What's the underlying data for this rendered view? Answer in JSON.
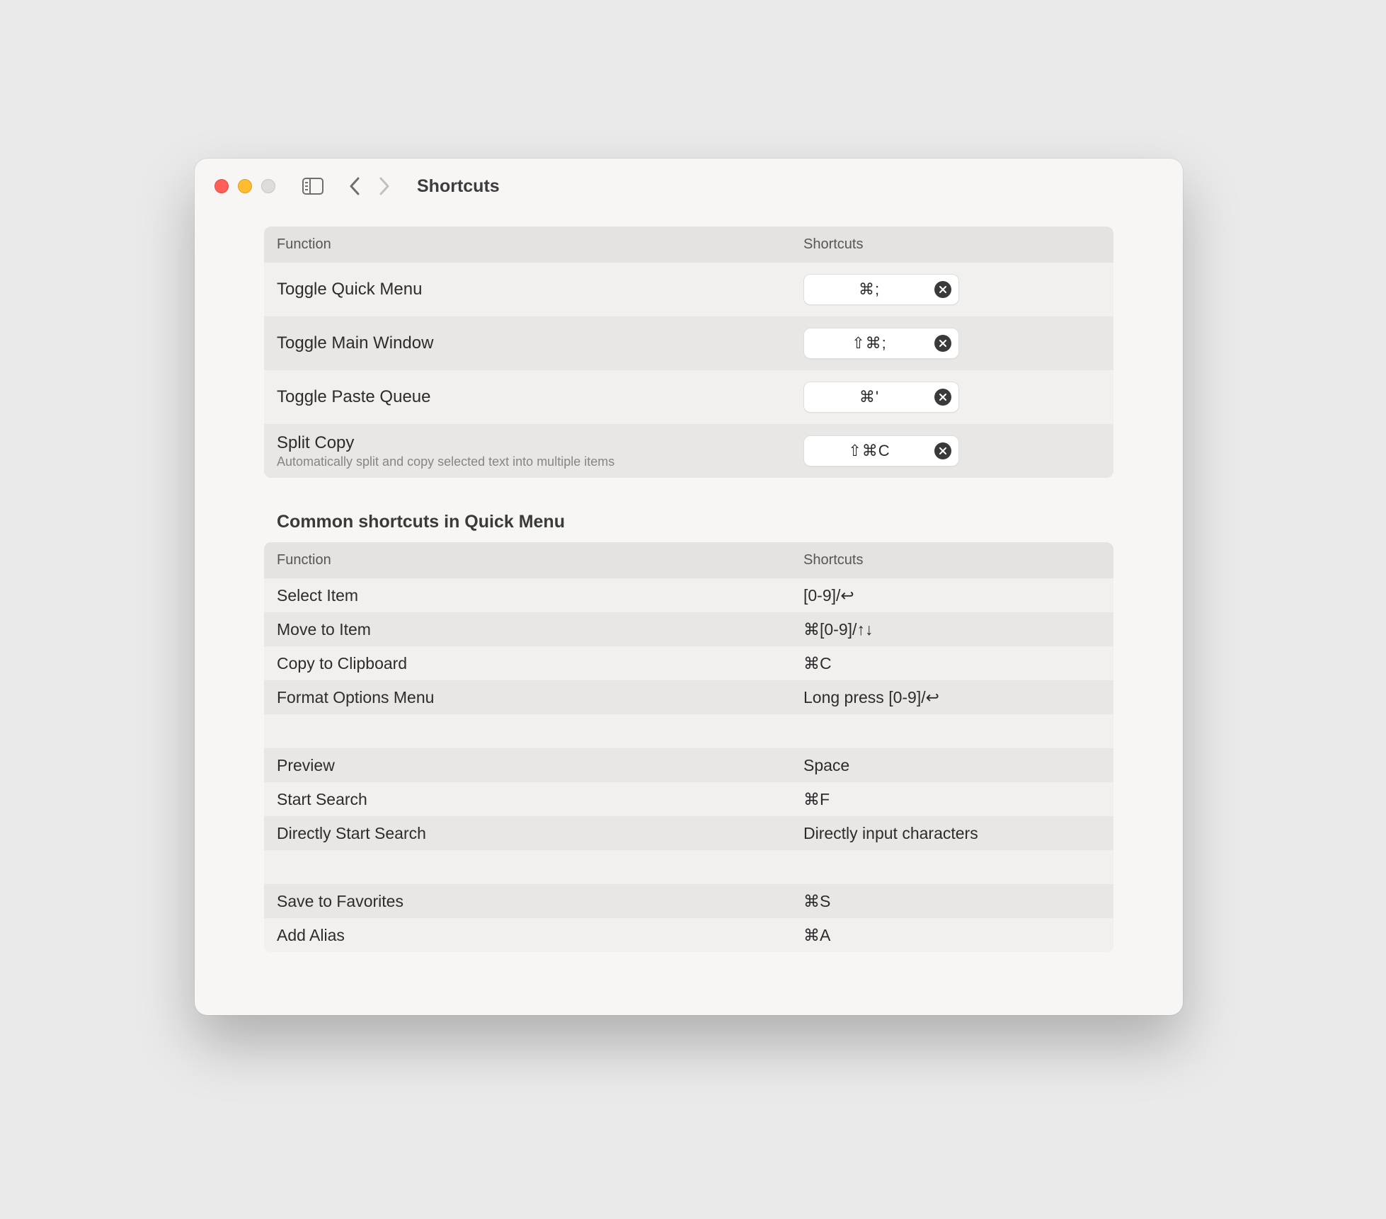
{
  "window": {
    "title": "Shortcuts"
  },
  "headers": {
    "function": "Function",
    "shortcuts": "Shortcuts"
  },
  "editable": [
    {
      "label": "Toggle Quick Menu",
      "sub": null,
      "key": "⌘;"
    },
    {
      "label": "Toggle Main Window",
      "sub": null,
      "key": "⇧⌘;"
    },
    {
      "label": "Toggle Paste Queue",
      "sub": null,
      "key": "⌘'"
    },
    {
      "label": "Split Copy",
      "sub": "Automatically split and copy selected text into multiple items",
      "key": "⇧⌘C"
    }
  ],
  "section_title": "Common shortcuts in Quick Menu",
  "readonly": [
    {
      "type": "row",
      "label": "Select Item",
      "key": "[0-9]/↩"
    },
    {
      "type": "row",
      "label": "Move to Item",
      "key": "⌘[0-9]/↑↓"
    },
    {
      "type": "row",
      "label": "Copy to Clipboard",
      "key": "⌘C"
    },
    {
      "type": "row",
      "label": "Format Options Menu",
      "key": "Long press [0-9]/↩"
    },
    {
      "type": "spacer"
    },
    {
      "type": "row",
      "label": "Preview",
      "key": "Space"
    },
    {
      "type": "row",
      "label": "Start Search",
      "key": "⌘F"
    },
    {
      "type": "row",
      "label": "Directly Start Search",
      "key": "Directly input characters"
    },
    {
      "type": "spacer"
    },
    {
      "type": "row",
      "label": "Save to Favorites",
      "key": "⌘S"
    },
    {
      "type": "row",
      "label": "Add Alias",
      "key": "⌘A"
    }
  ]
}
